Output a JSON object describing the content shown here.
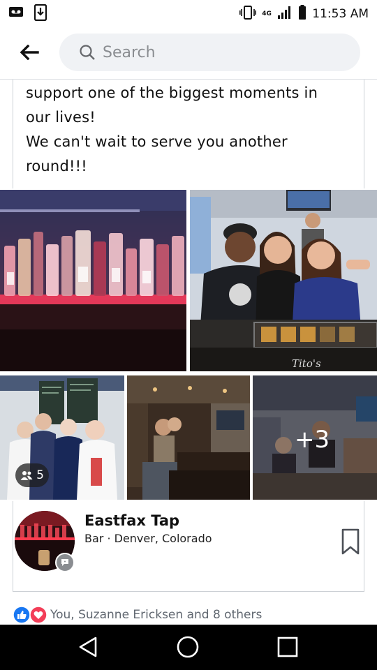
{
  "status_bar": {
    "time": "11:53 AM",
    "network": "4G",
    "icons": [
      "voicemail-icon",
      "download-icon",
      "vibrate-icon",
      "signal-icon",
      "battery-icon"
    ]
  },
  "app_bar": {
    "back_icon": "arrow-left-icon",
    "search_placeholder": "Search"
  },
  "post": {
    "text_lines": [
      "support one of the biggest moments in",
      "our lives!",
      "We can't wait to serve you another",
      "round!!!"
    ]
  },
  "photos": {
    "p2_sign": "Tito's",
    "tagged_count": "5",
    "more_count": "+3"
  },
  "place": {
    "name": "Eastfax Tap",
    "meta": "Bar · Denver, Colorado",
    "save_icon": "bookmark-icon"
  },
  "reactions": {
    "icons": [
      "like-icon",
      "love-icon"
    ],
    "text": "You, Suzanne Ericksen and 8 others"
  },
  "nav": {
    "icons": [
      "back-triangle-icon",
      "home-circle-icon",
      "recents-square-icon"
    ]
  },
  "colors": {
    "facebook_blue": "#1877f2",
    "love_red": "#f33e58",
    "search_bg": "#f0f2f5"
  }
}
